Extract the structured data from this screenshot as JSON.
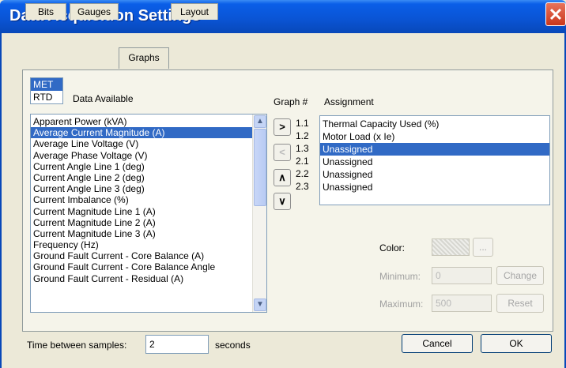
{
  "window": {
    "title": "Data Acquisition Settings",
    "close_glyph": "✕"
  },
  "tabs": [
    {
      "label": "Bits"
    },
    {
      "label": "Gauges"
    },
    {
      "label": "Graphs",
      "active": true
    },
    {
      "label": "Layout"
    }
  ],
  "category_tabs": [
    {
      "label": "MET",
      "selected": true
    },
    {
      "label": "RTD",
      "selected": false
    }
  ],
  "data_available": {
    "header": "Data Available",
    "items": [
      "Apparent Power (kVA)",
      "Average Current Magnitude (A)",
      "Average Line Voltage (V)",
      "Average Phase Voltage (V)",
      "Current Angle Line 1 (deg)",
      "Current Angle Line 2 (deg)",
      "Current Angle Line 3 (deg)",
      "Current Imbalance (%)",
      "Current Magnitude Line 1 (A)",
      "Current Magnitude Line 2 (A)",
      "Current Magnitude Line 3 (A)",
      "Frequency (Hz)",
      "Ground Fault Current - Core Balance (A)",
      "Ground Fault Current - Core Balance Angle",
      "Ground Fault Current - Residual (A)"
    ],
    "selected_index": 1
  },
  "move_buttons": {
    "add": ">",
    "remove": "<",
    "up": "∧",
    "down": "∨"
  },
  "assignment": {
    "graph_header": "Graph #",
    "header": "Assignment",
    "rows": [
      {
        "graph": "1.1",
        "value": "Thermal Capacity Used (%)"
      },
      {
        "graph": "1.2",
        "value": "Motor Load (x Ie)"
      },
      {
        "graph": "1.3",
        "value": "Unassigned"
      },
      {
        "graph": "2.1",
        "value": "Unassigned"
      },
      {
        "graph": "2.2",
        "value": "Unassigned"
      },
      {
        "graph": "2.3",
        "value": "Unassigned"
      }
    ],
    "selected_index": 2
  },
  "properties": {
    "color_label": "Color:",
    "color_button": "...",
    "minimum_label": "Minimum:",
    "minimum_value": "0",
    "maximum_label": "Maximum:",
    "maximum_value": "500",
    "change_button": "Change",
    "reset_button": "Reset"
  },
  "footer": {
    "samples_label": "Time between samples:",
    "samples_value": "2",
    "samples_unit": "seconds",
    "cancel": "Cancel",
    "ok": "OK"
  },
  "colors": {
    "title_bar": "#0a55d6",
    "selection": "#316ac5",
    "dialog_bg": "#ece9d8"
  }
}
